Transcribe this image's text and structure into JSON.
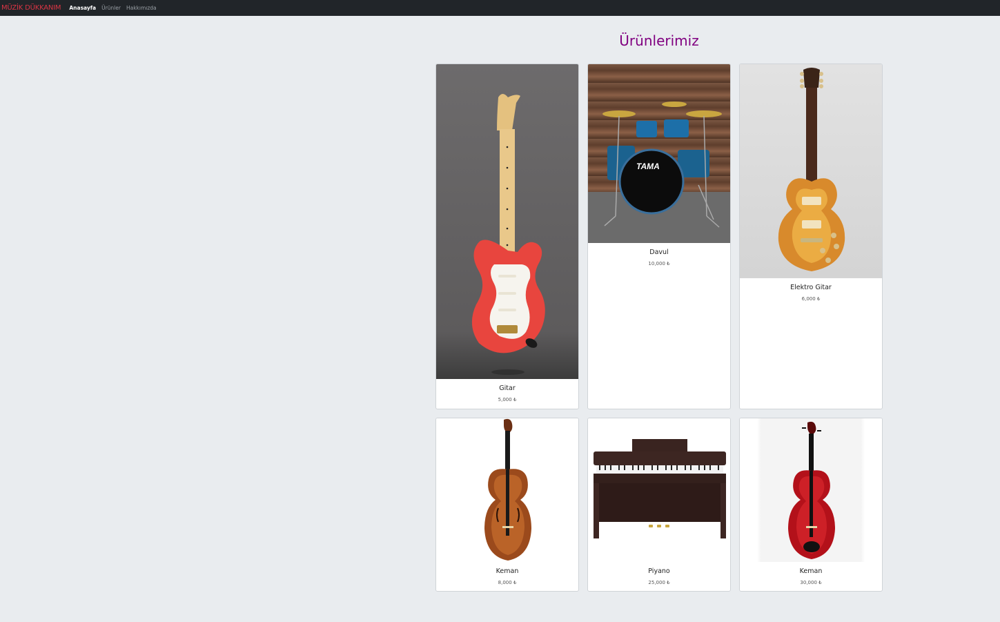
{
  "navbar": {
    "brand": "MÜZİK DÜKKANIM",
    "links": [
      "Anasayfa",
      "Ürünler",
      "Hakkımızda"
    ]
  },
  "page": {
    "title": "Ürünlerimiz"
  },
  "products": [
    {
      "name": "Gitar",
      "price": "5,000 ₺",
      "image": "electric-guitar-red"
    },
    {
      "name": "Davul",
      "price": "10,000 ₺",
      "image": "drum-kit"
    },
    {
      "name": "Elektro Gitar",
      "price": "6,000 ₺",
      "image": "electric-guitar-sunburst"
    },
    {
      "name": "Keman",
      "price": "8,000 ₺",
      "image": "violin-brown"
    },
    {
      "name": "Piyano",
      "price": "25,000 ₺",
      "image": "digital-piano"
    },
    {
      "name": "Keman",
      "price": "30,000 ₺",
      "image": "violin-red"
    }
  ],
  "colors": {
    "navbar": "#212529",
    "brand": "#dc3545",
    "title": "#800080",
    "background": "#e9ecef"
  }
}
